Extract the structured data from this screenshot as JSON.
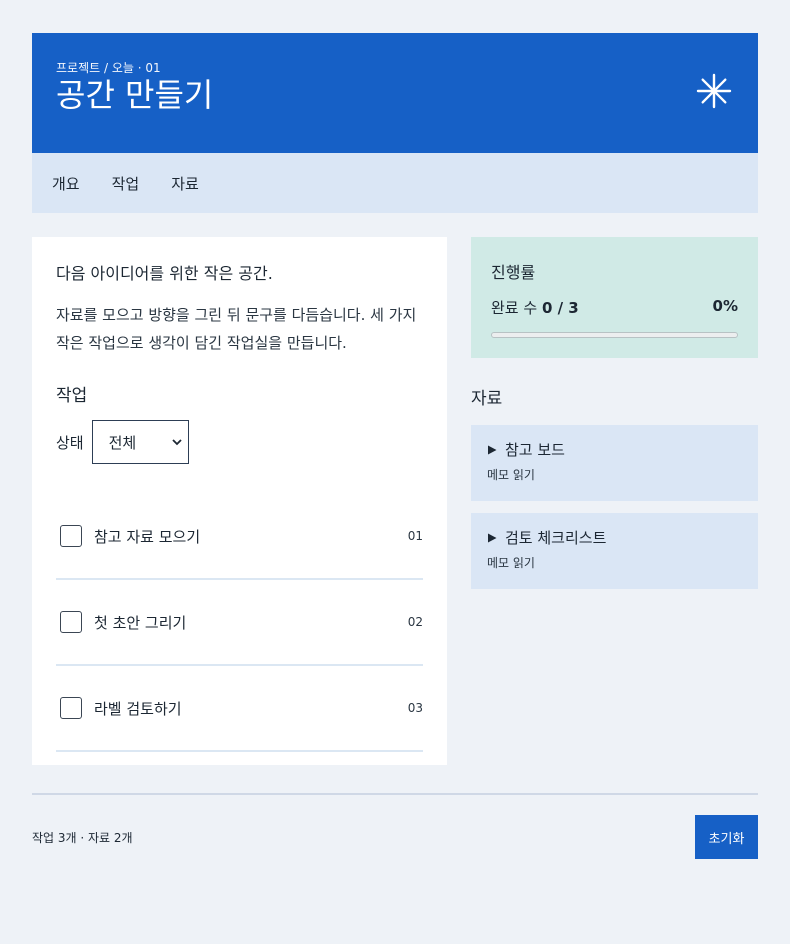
{
  "header": {
    "breadcrumb": "프로젝트 / 오늘 · 01",
    "title": "공간 만들기",
    "icon": "asterisk-icon"
  },
  "tabs": [
    {
      "label": "개요"
    },
    {
      "label": "작업"
    },
    {
      "label": "자료"
    }
  ],
  "main": {
    "lead": "다음 아이디어를 위한 작은 공간.",
    "description": "자료를 모으고 방향을 그린 뒤 문구를 다듬습니다. 세 가지 작은 작업으로 생각이 담긴 작업실을 만듭니다.",
    "tasks_title": "작업",
    "filter_label": "상태",
    "filter_value": "전체",
    "tasks": [
      {
        "label": "참고 자료 모으기",
        "num": "01",
        "checked": false
      },
      {
        "label": "첫 초안 그리기",
        "num": "02",
        "checked": false
      },
      {
        "label": "라벨 검토하기",
        "num": "03",
        "checked": false
      }
    ]
  },
  "progress": {
    "title": "진행률",
    "done_label": "완료 수",
    "done_value": "0 / 3",
    "percent": "0%",
    "fraction": 0
  },
  "resources": {
    "title": "자료",
    "items": [
      {
        "title": "참고 보드",
        "sub": "메모 읽기"
      },
      {
        "title": "검토 체크리스트",
        "sub": "메모 읽기"
      }
    ]
  },
  "footer": {
    "summary": "작업 3개 · 자료 2개",
    "reset_label": "초기화"
  },
  "colors": {
    "accent": "#1660c6",
    "tabs_bg": "#dae6f5",
    "progress_bg": "#d0eae6"
  }
}
